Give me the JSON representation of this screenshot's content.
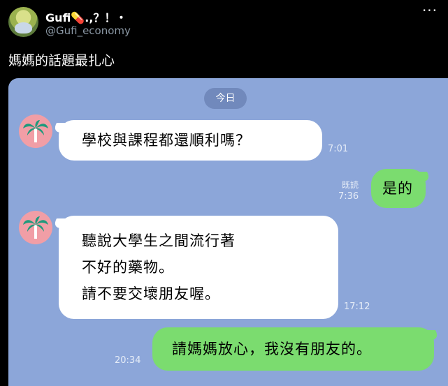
{
  "tweet": {
    "display_name": "Gufi💊.,？！・",
    "handle": "@Gufi_economy",
    "more_label": "···",
    "text": "媽媽的話題最扎心"
  },
  "chat": {
    "background": "#8ca6d9",
    "date_label": "今日",
    "messages": [
      {
        "from": "mom",
        "lines": [
          "學校與課程都還順利嗎？"
        ],
        "time": "7:01"
      },
      {
        "from": "me",
        "lines": [
          "是的"
        ],
        "read": "既読",
        "time": "7:36"
      },
      {
        "from": "mom",
        "lines": [
          "聽說大學生之間流行著",
          "不好的藥物。",
          "請不要交壞朋友喔。"
        ],
        "time": "17:12"
      },
      {
        "from": "me",
        "lines": [
          "請媽媽放心，我沒有朋友的。"
        ],
        "time": "20:34"
      }
    ]
  },
  "colors": {
    "incoming_bubble": "#ffffff",
    "outgoing_bubble": "#7bdc6f",
    "avatar_bg": "#f19ea6"
  },
  "icons": {
    "contact_avatar": "palm-tree-icon"
  }
}
